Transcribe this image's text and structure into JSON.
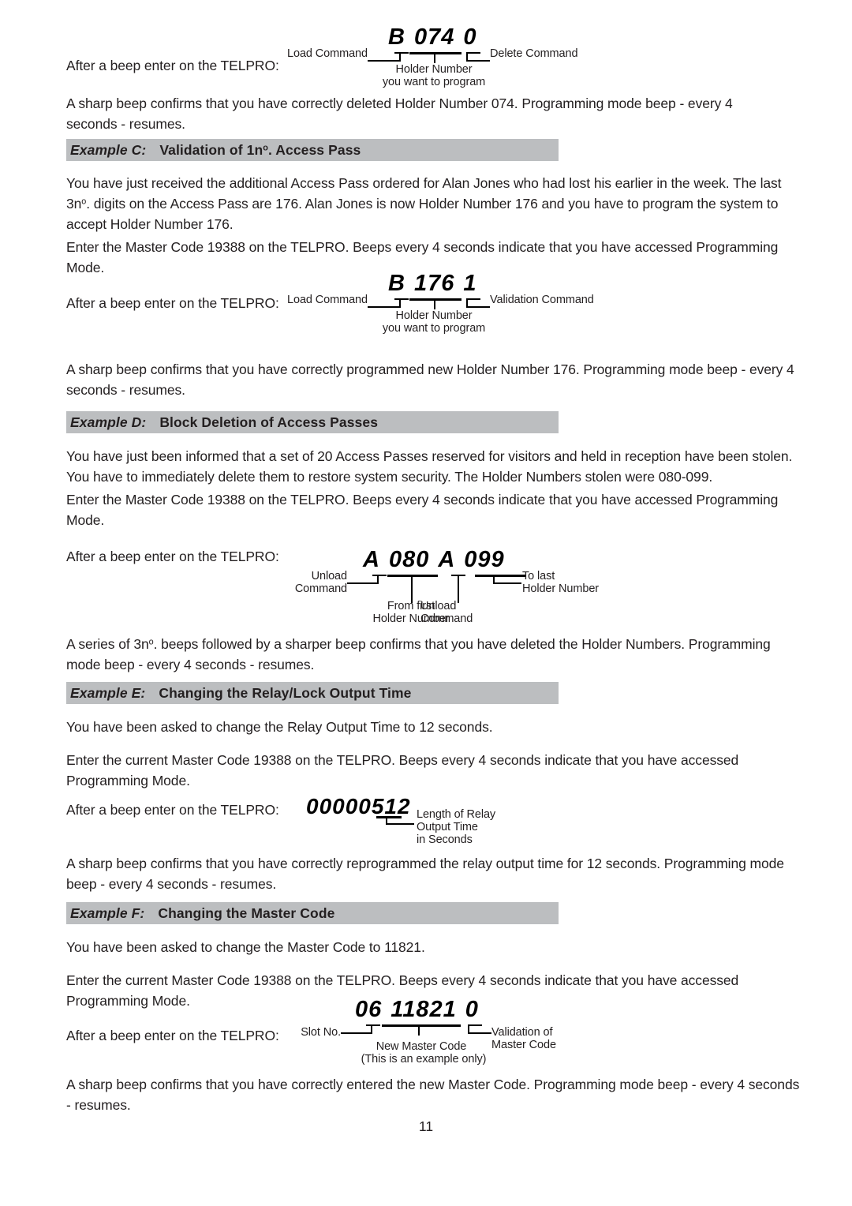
{
  "document": {
    "page_number": "11"
  },
  "top_block": {
    "lead": "After a beep enter on the TELPRO:",
    "code": {
      "c1": "B",
      "c2": "074",
      "c3": "0"
    },
    "labels": {
      "load_command": "Load Command",
      "delete_command": "Delete Command",
      "holder_number_l1": "Holder Number",
      "holder_number_l2": "you want to program"
    },
    "confirm": "A sharp beep confirms that you have correctly deleted Holder Number 074. Programming mode beep - every 4 seconds - resumes."
  },
  "example_c": {
    "label": "Example C:",
    "title_pre": "Validation of 1n",
    "title_sup": "o",
    "title_post": ". Access Pass",
    "body_pre": "You have just received the additional Access Pass ordered for Alan Jones who had lost his earlier in the week. The last 3n",
    "body_sup": "o",
    "body_post": ". digits on the Access Pass are 176. Alan Jones is now Holder Number 176 and you have to program the system to accept Holder Number 176.",
    "master_code": "Enter the Master Code 19388 on the TELPRO. Beeps every 4 seconds indicate that you have accessed Programming Mode.",
    "lead": "After a beep enter on the TELPRO:",
    "code": {
      "c1": "B",
      "c2": "176",
      "c3": "1"
    },
    "labels": {
      "load_command": "Load Command",
      "validation_command": "Validation Command",
      "holder_number_l1": "Holder Number",
      "holder_number_l2": "you want to program"
    },
    "confirm": "A sharp beep confirms that you have correctly programmed new Holder Number 176. Programming mode beep - every 4 seconds - resumes."
  },
  "example_d": {
    "label": "Example D:",
    "title": "Block Deletion of Access Passes",
    "body": "You have just been informed that a set of 20 Access Passes reserved for visitors and held in reception have been stolen. You have to immediately delete them to restore system security. The Holder Numbers stolen were 080-099.",
    "master_code": "Enter the Master Code 19388 on the TELPRO. Beeps every 4 seconds indicate that you have accessed Programming Mode.",
    "lead": "After a beep enter on the TELPRO:",
    "code": {
      "c1": "A",
      "c2": "080",
      "c3": "A",
      "c4": "099"
    },
    "labels": {
      "unload_command_l1": "Unload",
      "unload_command_l2": "Command",
      "to_last_l1": "To last",
      "to_last_l2": "Holder Number",
      "from_first_l1": "From first",
      "from_first_l2": "Holder Number",
      "unload_command2_l1": "Unload",
      "unload_command2_l2": "Command"
    },
    "confirm_pre": "A series of 3n",
    "confirm_sup": "o",
    "confirm_post": ". beeps followed by a sharper beep confirms that you have deleted the Holder Numbers. Programming mode beep - every 4 seconds - resumes."
  },
  "example_e": {
    "label": "Example E:",
    "title": "Changing the Relay/Lock Output Time",
    "body": "You have been asked to change the Relay Output Time to 12 seconds.",
    "master_code": "Enter the current Master Code 19388 on the TELPRO. Beeps every 4 seconds indicate that you have accessed Programming Mode.",
    "lead": "After a beep enter on the TELPRO:",
    "code": {
      "c1": "00000512"
    },
    "labels": {
      "length_l1": "Length of Relay",
      "length_l2": "Output Time",
      "length_l3": "in Seconds"
    },
    "confirm": "A sharp beep confirms that you have correctly reprogrammed the relay output time for 12 seconds. Programming mode beep - every 4 seconds - resumes."
  },
  "example_f": {
    "label": "Example F:",
    "title": "Changing the Master Code",
    "body": "You have been asked to change the Master Code to 11821.",
    "master_code": "Enter the current Master Code 19388 on the TELPRO. Beeps every 4 seconds indicate that you have accessed Programming Mode.",
    "lead": "After a beep enter on the TELPRO:",
    "code": {
      "c1": "06",
      "c2": "11821",
      "c3": "0"
    },
    "labels": {
      "slot_no": "Slot No.",
      "validation_l1": "Validation of",
      "validation_l2": "Master Code",
      "new_master_l1": "New Master Code",
      "new_master_l2": "(This is an example only)"
    },
    "confirm": "A sharp beep confirms that you have correctly entered the new Master Code. Programming mode beep - every 4 seconds - resumes."
  },
  "colors": {
    "heading_bar": "#bcbec0",
    "text": "#231f20"
  }
}
